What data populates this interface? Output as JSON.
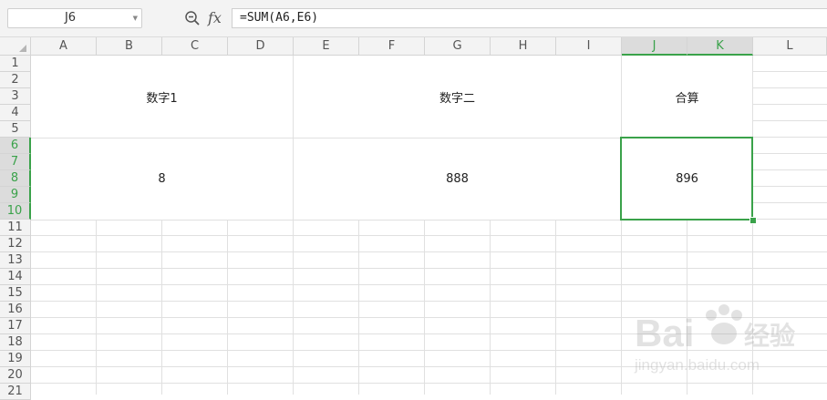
{
  "formula_bar": {
    "name_box": "J6",
    "fx_label": "fx",
    "formula": "=SUM(A6,E6)"
  },
  "columns": [
    "A",
    "B",
    "C",
    "D",
    "E",
    "F",
    "G",
    "H",
    "I",
    "J",
    "K",
    "L"
  ],
  "selected_columns": [
    "J",
    "K"
  ],
  "rows": [
    "1",
    "2",
    "3",
    "4",
    "5",
    "6",
    "7",
    "8",
    "9",
    "10",
    "11",
    "12",
    "13",
    "14",
    "15",
    "16",
    "17",
    "18",
    "19",
    "20",
    "21"
  ],
  "selected_rows": [
    "6",
    "7",
    "8",
    "9",
    "10"
  ],
  "cells": {
    "header_num1": "数字1",
    "header_num2": "数字二",
    "header_total": "合算",
    "value_num1": "8",
    "value_num2": "888",
    "value_total": "896"
  },
  "active_cell": "J6",
  "watermark": {
    "brand": "Bai",
    "brand_cn": "经验",
    "url": "jingyan.baidu.com"
  },
  "colors": {
    "selection": "#3aa24a",
    "header_bg": "#f3f3f3",
    "selected_header_bg": "#dcdcdc",
    "gridline": "#e0e0e0"
  },
  "icons": {
    "zoom": "zoom-icon",
    "dropdown": "chevron-down-icon",
    "select_all": "select-all-triangle-icon"
  }
}
